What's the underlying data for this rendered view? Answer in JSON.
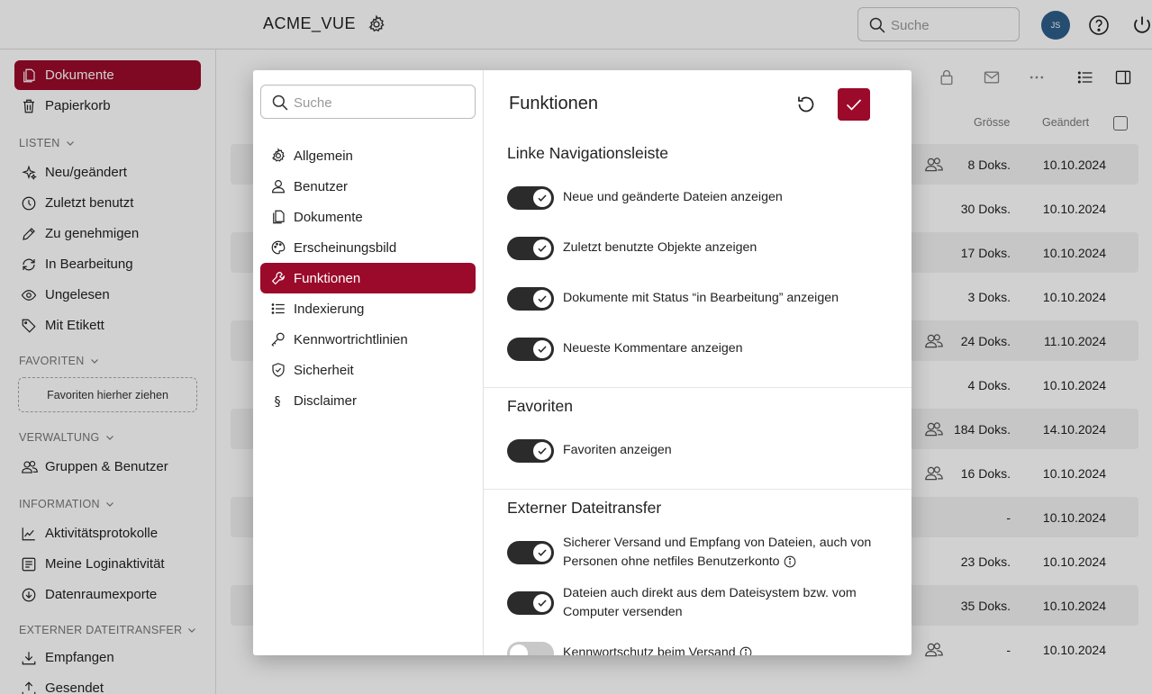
{
  "header": {
    "app_title": "ACME_VUE",
    "search_placeholder": "Suche",
    "avatar_initials": "JS"
  },
  "sidebar": {
    "top_items": [
      {
        "label": "Dokumente",
        "icon": "documents-icon",
        "active": true
      },
      {
        "label": "Papierkorb",
        "icon": "trash-icon"
      }
    ],
    "lists_label": "LISTEN",
    "lists": [
      {
        "label": "Neu/geändert",
        "icon": "sparkle-icon"
      },
      {
        "label": "Zuletzt benutzt",
        "icon": "clock-icon"
      },
      {
        "label": "Zu genehmigen",
        "icon": "pencil-icon"
      },
      {
        "label": "In Bearbeitung",
        "icon": "refresh-icon"
      },
      {
        "label": "Ungelesen",
        "icon": "eye-icon"
      },
      {
        "label": "Mit Etikett",
        "icon": "tag-icon"
      }
    ],
    "favorites_label": "FAVORITEN",
    "favorites_drop": "Favoriten hierher ziehen",
    "admin_label": "VERWALTUNG",
    "admin": [
      {
        "label": "Gruppen & Benutzer",
        "icon": "users-icon"
      }
    ],
    "info_label": "INFORMATION",
    "info": [
      {
        "label": "Aktivitätsprotokolle",
        "icon": "chart-icon"
      },
      {
        "label": "Meine Loginaktivität",
        "icon": "list-icon"
      },
      {
        "label": "Datenraumexporte",
        "icon": "download-circle-icon"
      }
    ],
    "transfer_label": "EXTERNER DATEITRANSFER",
    "transfer": [
      {
        "label": "Empfangen",
        "icon": "download-icon"
      },
      {
        "label": "Gesendet",
        "icon": "upload-icon"
      }
    ]
  },
  "table": {
    "col_size": "Grösse",
    "col_changed": "Geändert",
    "rows": [
      {
        "size": "8 Doks.",
        "date": "10.10.2024",
        "group": true
      },
      {
        "size": "30 Doks.",
        "date": "10.10.2024",
        "group": false
      },
      {
        "size": "17 Doks.",
        "date": "10.10.2024",
        "group": false
      },
      {
        "size": "3 Doks.",
        "date": "10.10.2024",
        "group": false
      },
      {
        "size": "24 Doks.",
        "date": "11.10.2024",
        "group": true
      },
      {
        "size": "4 Doks.",
        "date": "10.10.2024",
        "group": false
      },
      {
        "size": "184 Doks.",
        "date": "14.10.2024",
        "group": true
      },
      {
        "size": "16 Doks.",
        "date": "10.10.2024",
        "group": true
      },
      {
        "size": "-",
        "date": "10.10.2024",
        "group": false
      },
      {
        "size": "23 Doks.",
        "date": "10.10.2024",
        "group": false
      },
      {
        "size": "35 Doks.",
        "date": "10.10.2024",
        "group": false
      },
      {
        "size": "-",
        "date": "10.10.2024",
        "group": true
      }
    ]
  },
  "modal": {
    "search_placeholder": "Suche",
    "nav": [
      {
        "label": "Allgemein",
        "icon": "gear-icon"
      },
      {
        "label": "Benutzer",
        "icon": "user-icon"
      },
      {
        "label": "Dokumente",
        "icon": "documents-icon"
      },
      {
        "label": "Erscheinungsbild",
        "icon": "palette-icon"
      },
      {
        "label": "Funktionen",
        "icon": "wrench-icon",
        "active": true
      },
      {
        "label": "Indexierung",
        "icon": "list-icon"
      },
      {
        "label": "Kennwortrichtlinien",
        "icon": "key-icon"
      },
      {
        "label": "Sicherheit",
        "icon": "shield-icon"
      },
      {
        "label": "Disclaimer",
        "icon": "paragraph-icon"
      }
    ],
    "title": "Funktionen",
    "sections": {
      "nav_title": "Linke Navigationsleiste",
      "nav_toggles": [
        {
          "label": "Neue und geänderte Dateien anzeigen",
          "on": true
        },
        {
          "label": "Zuletzt benutzte Objekte anzeigen",
          "on": true
        },
        {
          "label": "Dokumente mit Status “in Bearbeitung” anzeigen",
          "on": true
        },
        {
          "label": "Neueste Kommentare anzeigen",
          "on": true
        }
      ],
      "fav_title": "Favoriten",
      "fav_toggles": [
        {
          "label": "Favoriten anzeigen",
          "on": true
        }
      ],
      "ext_title": "Externer Dateitransfer",
      "ext_toggles": [
        {
          "label": "Sicherer Versand und Empfang von Dateien, auch von Personen ohne netfiles Benutzerkonto",
          "on": true,
          "info": true
        },
        {
          "label": "Dateien auch direkt aus dem Dateisystem bzw. vom Computer versenden",
          "on": true
        },
        {
          "label": "Kennwortschutz beim Versand",
          "on": false,
          "info": true
        }
      ]
    }
  },
  "colors": {
    "accent": "#9b0a2a",
    "toggle_on": "#2b2b2b",
    "avatar": "#2d5f8a"
  }
}
